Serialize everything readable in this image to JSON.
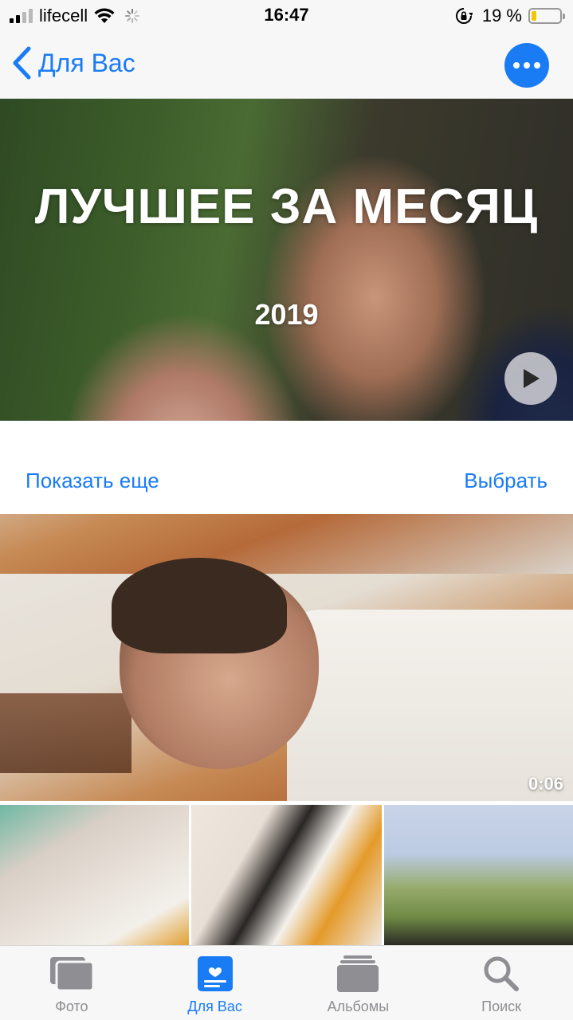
{
  "status_bar": {
    "carrier": "lifecell",
    "time": "16:47",
    "battery_percent": "19 %",
    "battery_level": 0.19,
    "signal_bars": 4,
    "signal_bars_active": 2
  },
  "nav": {
    "back_label": "Для Вас",
    "more_icon": "ellipsis-icon"
  },
  "hero": {
    "title": "ЛУЧШЕЕ ЗА МЕСЯЦ",
    "year": "2019",
    "play_icon": "play-icon"
  },
  "actions": {
    "show_more": "Показать еще",
    "select": "Выбрать"
  },
  "media": {
    "video_duration": "0:06"
  },
  "tabs": [
    {
      "label": "Фото",
      "icon": "photos-icon",
      "active": false
    },
    {
      "label": "Для Вас",
      "icon": "for-you-icon",
      "active": true
    },
    {
      "label": "Альбомы",
      "icon": "albums-icon",
      "active": false
    },
    {
      "label": "Поиск",
      "icon": "search-icon",
      "active": false
    }
  ],
  "colors": {
    "accent": "#1a7cf5",
    "inactive": "#8e8e93",
    "battery": "#f0c800"
  }
}
